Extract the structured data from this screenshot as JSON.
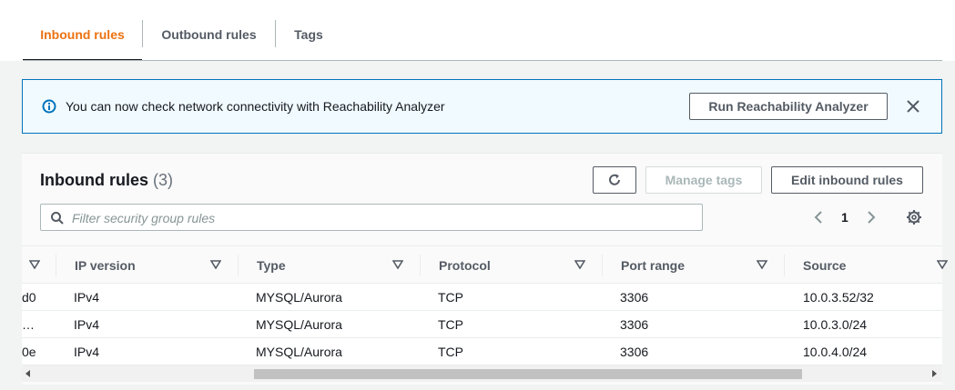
{
  "tabs": [
    {
      "label": "Inbound rules",
      "active": true
    },
    {
      "label": "Outbound rules",
      "active": false
    },
    {
      "label": "Tags",
      "active": false
    }
  ],
  "banner": {
    "message": "You can now check network connectivity with Reachability Analyzer",
    "button_label": "Run Reachability Analyzer",
    "icon": "info-icon"
  },
  "panel": {
    "title": "Inbound rules",
    "count": "(3)",
    "refresh_icon": "refresh-icon",
    "manage_tags_label": "Manage tags",
    "edit_rules_label": "Edit inbound rules",
    "search_placeholder": "Filter security group rules",
    "current_page": "1"
  },
  "table": {
    "columns": [
      "IP version",
      "Type",
      "Protocol",
      "Port range",
      "Source"
    ],
    "rows": [
      {
        "id_tail": "d0",
        "ip_version": "IPv4",
        "type": "MYSQL/Aurora",
        "protocol": "TCP",
        "port_range": "3306",
        "source": "10.0.3.52/32"
      },
      {
        "id_tail": "…",
        "ip_version": "IPv4",
        "type": "MYSQL/Aurora",
        "protocol": "TCP",
        "port_range": "3306",
        "source": "10.0.3.0/24"
      },
      {
        "id_tail": "0e",
        "ip_version": "IPv4",
        "type": "MYSQL/Aurora",
        "protocol": "TCP",
        "port_range": "3306",
        "source": "10.0.4.0/24"
      }
    ]
  },
  "colors": {
    "active_tab": "#ec7211",
    "banner_border": "#0073bb",
    "banner_bg": "#f1faff",
    "info_icon": "#0073bb"
  }
}
